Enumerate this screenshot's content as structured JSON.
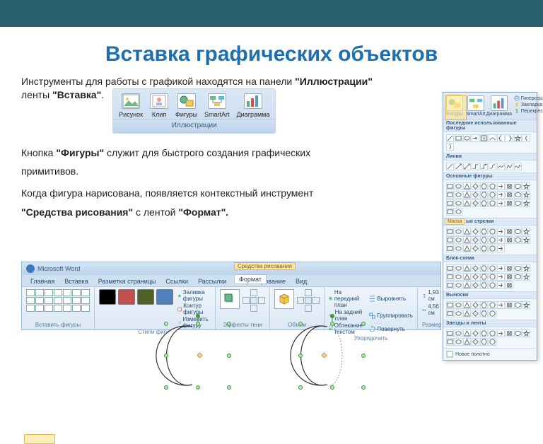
{
  "title": "Вставка графических объектов",
  "para1_a": "Инструменты для работы с графикой находятся на панели  ",
  "para1_b": "\"Иллюстрации\"",
  "para1_c": " ленты ",
  "para1_d": "\"Вставка\"",
  "para1_e": ".",
  "para2_a": "Кнопка ",
  "para2_b": "\"Фигуры\"",
  "para2_c": " служит для быстрого создания графических",
  "para2_d": "примитивов.",
  "para3_a": "Когда фигура нарисована, появляется контекстный инструмент ",
  "para3_b": "\"Средства рисования\"",
  "para3_c": " с лентой ",
  "para3_d": "\"Формат\".",
  "illus": {
    "caption": "Иллюстрации",
    "buttons": [
      "Рисунок",
      "Клип",
      "Фигуры",
      "SmartArt",
      "Диаграмма"
    ]
  },
  "ribbon": {
    "wintitle": "Microsoft Word",
    "context": "Средства рисования",
    "tabs": [
      "Главная",
      "Вставка",
      "Разметка страницы",
      "Ссылки",
      "Рассылки",
      "Рецензирование",
      "Вид",
      "Формат"
    ],
    "groups": {
      "g1": "Вставить фигуры",
      "g2": "Стили фигур",
      "g3": "Эффекты тени",
      "g4": "Объем",
      "g5": "Упорядочить",
      "g6": "Размер"
    },
    "links": {
      "fill": "Заливка фигуры",
      "outline": "Контур фигуры",
      "change": "Изменить фигуру",
      "shadow": "Эффекты тени",
      "front": "На передний план",
      "back": "На задний план",
      "wrap": "Обтекание текстом",
      "align": "Выровнять",
      "group": "Группировать",
      "rotate": "Повернуть"
    },
    "size": {
      "h": "1,93 см",
      "w": "4,56 см"
    }
  },
  "popup": {
    "head": [
      "Фигуры",
      "SmartArt",
      "Диаграмма"
    ],
    "links": [
      "Гиперссылка",
      "Закладка",
      "Перекрест"
    ],
    "sec_recent": "Последние использованные фигуры",
    "sec_lines": "Линии",
    "sec_basic": "Основные фигуры",
    "sec_arrows": "ые стрелки",
    "arrows_tag": "Маска",
    "sec_flow": "Блок-схема",
    "sec_call": "Выноски",
    "sec_stars": "Звезды и ленты",
    "foot": "Новое полотно"
  }
}
